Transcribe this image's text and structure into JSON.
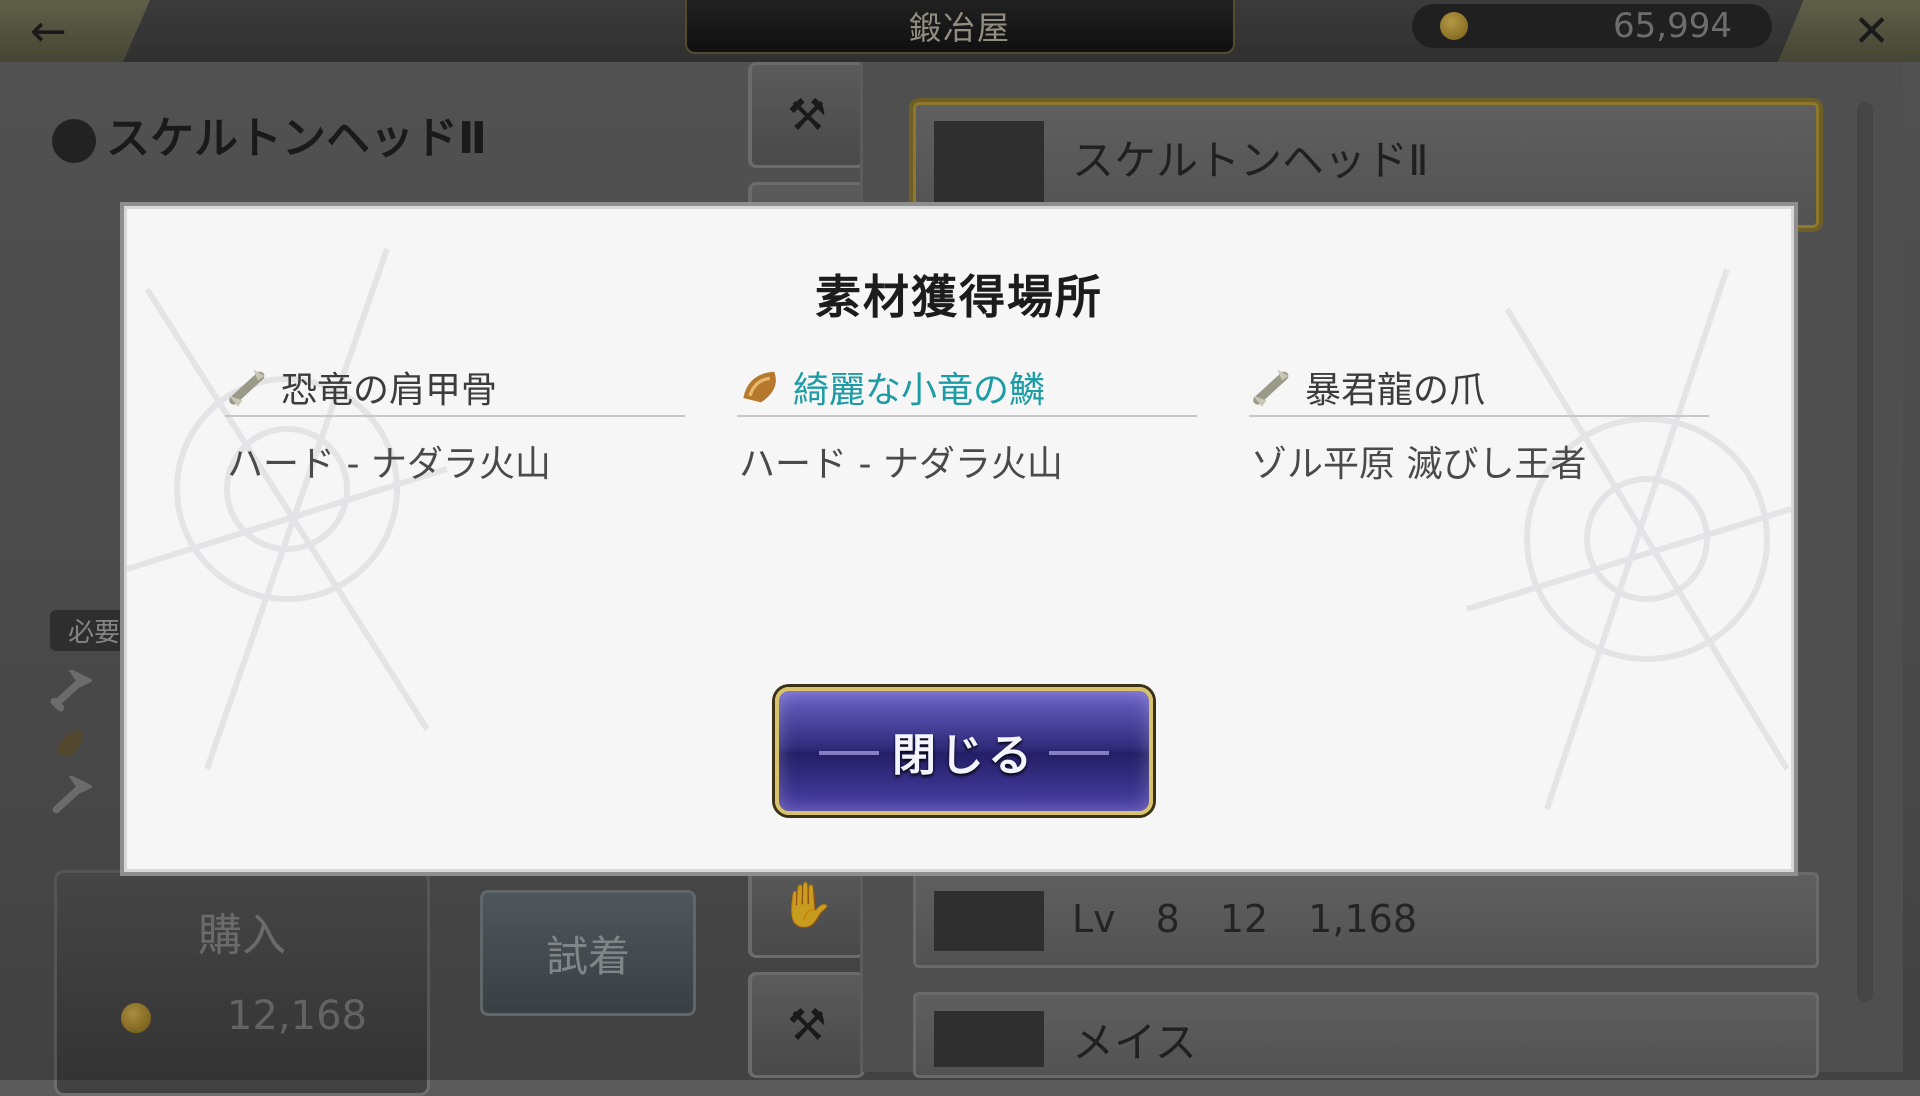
{
  "header": {
    "back_icon": "arrow-left-icon",
    "title": "鍛冶屋",
    "coins": "65,994",
    "close_icon": "close-icon"
  },
  "left_panel": {
    "item_name": "スケルトンヘッドⅡ",
    "need_label": "必要",
    "buy": {
      "label": "購入",
      "price": "12,168"
    },
    "try_on": "試着"
  },
  "right_panel": {
    "rows": [
      {
        "name": "スケルトンヘッドⅡ"
      },
      {
        "lv_label": "Lv",
        "lv": "8",
        "atk": "12",
        "price": "1,168"
      },
      {
        "name": "メイス"
      }
    ]
  },
  "modal": {
    "title": "素材獲得場所",
    "materials": [
      {
        "name": "恐竜の肩甲骨",
        "location": "ハード - ナダラ火山",
        "icon": "bone-icon",
        "highlight": false
      },
      {
        "name": "綺麗な小竜の鱗",
        "location": "ハード - ナダラ火山",
        "icon": "scale-icon",
        "highlight": true
      },
      {
        "name": "暴君龍の爪",
        "location": "ゾル平原 滅びし王者",
        "icon": "claw-icon",
        "highlight": false
      }
    ],
    "close_label": "閉じる"
  },
  "colors": {
    "highlight": "#1d9ca6",
    "button_gold": "#d8c26c",
    "button_purple": "#2f2a7a"
  }
}
